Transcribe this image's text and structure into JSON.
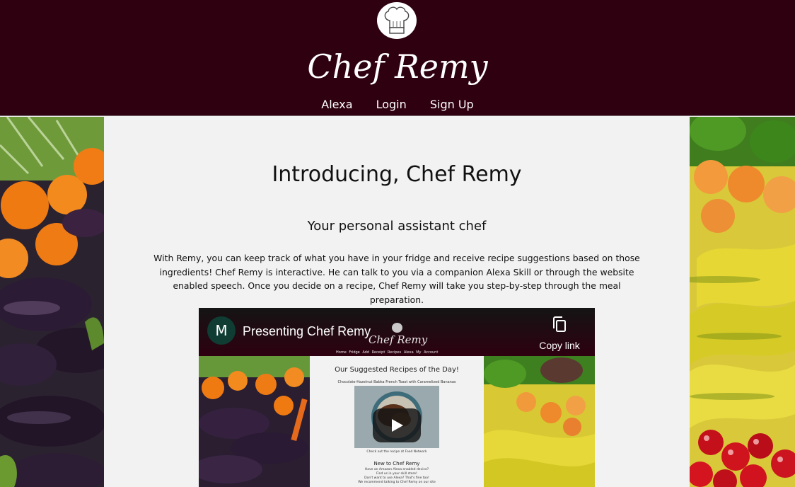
{
  "header": {
    "brand": "Chef Remy",
    "nav": [
      "Alexa",
      "Login",
      "Sign Up"
    ],
    "logo_icon": "chef-hat-icon",
    "background": "#2e0010"
  },
  "main": {
    "title": "Introducing, Chef Remy",
    "subtitle": "Your personal assistant chef",
    "description": "With Remy, you can keep track of what you have in your fridge and receive recipe suggestions based on those ingredients! Chef Remy is interactive. He can talk to you via a companion Alexa Skill or through the website enabled speech. Once you decide on a recipe, Chef Remy will take you step-by-step through the meal preparation."
  },
  "video": {
    "channel_initial": "M",
    "title": "Presenting Chef Remy",
    "copy_label": "Copy link",
    "preview": {
      "brand": "Chef Remy",
      "nav": [
        "Home",
        "Fridge",
        "Add Receipt",
        "Recipes",
        "Alexa",
        "My Account"
      ],
      "heading": "Our Suggested Recipes of the Day!",
      "recipe": "Chocolate-Hazelnut Babka French Toast with Caramelized Bananas",
      "caption": "Check out the recipe at Food Network",
      "new_heading": "New to Chef Remy",
      "new_lines": [
        "Have an Amazon Alexa enabled device?",
        "Find us in your skill store!",
        "Don't want to use Alexa? That's fine too!",
        "We recommend talking to Chef Remy on our site"
      ]
    }
  }
}
